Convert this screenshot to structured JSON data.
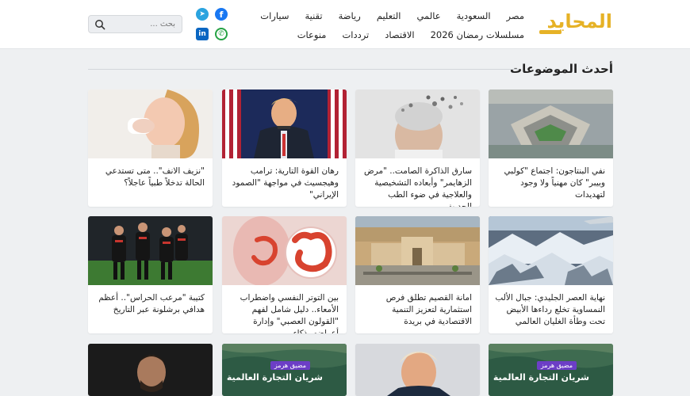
{
  "site": {
    "logo_text": "المحايد"
  },
  "nav": {
    "row1": [
      "مصر",
      "السعودية",
      "عالمي",
      "التعليم",
      "رياضة",
      "تقنية",
      "سيارات"
    ],
    "row2": [
      "مسلسلات رمضان 2026",
      "الاقتصاد",
      "ترددات",
      "منوعات"
    ]
  },
  "social": {
    "facebook": "f",
    "telegram": "➤",
    "whatsapp": "✆",
    "linkedin": "in"
  },
  "search": {
    "placeholder": "بحث ..."
  },
  "section": {
    "title": "أحدث الموضوعات"
  },
  "cards": [
    {
      "title": "نفي البنتاجون: اجتماع \"كولبي وبيبر\" كان مهنياً ولا وجود لتهديدات",
      "image": "pentagon-aerial"
    },
    {
      "title": "سارق الذاكرة الصامت.. \"مرض الزهايمر\" وأبعاده التشخيصية والعلاجية في ضوء الطب الحديث",
      "image": "alzheimer-head"
    },
    {
      "title": "رهان القوة التارية: ترامب وهيجسيث في مواجهة \"الصمود الإيراني\"",
      "image": "trump-podium"
    },
    {
      "title": "\"نزيف الانف\".. متى تستدعي الحالة تدخلاً طبياً عاجلاً؟",
      "image": "nosebleed-woman"
    },
    {
      "title": "نهاية العصر الجليدي: جبال الألب النمساوية تخلع رداءها الأبيض تحت وطأة الغليان العالمي",
      "image": "alps-aerial"
    },
    {
      "title": "امانة القصيم تطلق فرص استثمارية لتعزيز التنمية الاقتصادية في بريدة",
      "image": "qassim-building"
    },
    {
      "title": "بين التوتر النفسي واضطراب الأمعاء.. دليل شامل لفهم \"القولون العصبي\" وإدارة أعراضه بذكاء",
      "image": "colon-illustration"
    },
    {
      "title": "كتيبة \"مرعب الحراس\".. أعظم هدافي برشلونة عبر التاريخ",
      "image": "football-players"
    },
    {
      "title": "",
      "image": "trade-route-map",
      "tag": "مضيق هرمز",
      "caption": "شريان التجارة العالمية"
    },
    {
      "title": "",
      "image": "trump-portrait"
    },
    {
      "title": "",
      "image": "trade-route-map",
      "tag": "مضيق هرمز",
      "caption": "شريان التجارة العالمية"
    },
    {
      "title": "",
      "image": "actor-portrait"
    }
  ],
  "colors": {
    "logo": "#e6b226",
    "background": "#eef0f2",
    "tag": "#6c3ec6"
  }
}
